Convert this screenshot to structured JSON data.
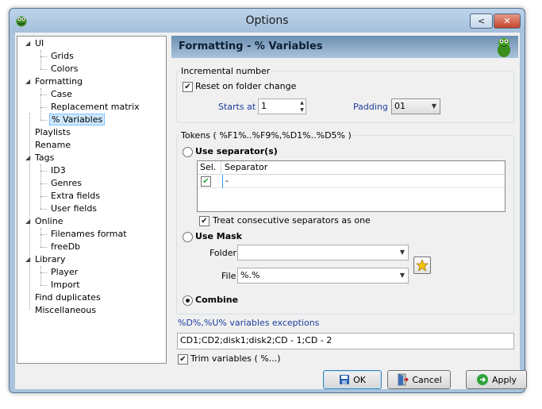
{
  "window": {
    "title": "Options",
    "minimize_glyph": "<",
    "close_glyph": "✕"
  },
  "tree": {
    "items": [
      {
        "label": "UI",
        "expander": "◢"
      },
      {
        "label": "Grids"
      },
      {
        "label": "Colors"
      },
      {
        "label": "Formatting",
        "expander": "◢"
      },
      {
        "label": "Case"
      },
      {
        "label": "Replacement matrix"
      },
      {
        "label": "% Variables",
        "selected": true
      },
      {
        "label": "Playlists"
      },
      {
        "label": "Rename"
      },
      {
        "label": "Tags",
        "expander": "◢"
      },
      {
        "label": "ID3"
      },
      {
        "label": "Genres"
      },
      {
        "label": "Extra fields"
      },
      {
        "label": "User fields"
      },
      {
        "label": "Online",
        "expander": "◢"
      },
      {
        "label": "Filenames format"
      },
      {
        "label": "freeDb"
      },
      {
        "label": "Library",
        "expander": "◢"
      },
      {
        "label": "Player"
      },
      {
        "label": "Import"
      },
      {
        "label": "Find duplicates"
      },
      {
        "label": "Miscellaneous"
      }
    ]
  },
  "panel": {
    "title": "Formatting - % Variables",
    "incremental": {
      "title": "Incremental number",
      "reset_label": "Reset on folder change",
      "reset_checked": true,
      "starts_at_label": "Starts at",
      "starts_at_value": "1",
      "padding_label": "Padding",
      "padding_value": "01"
    },
    "tokens": {
      "title": "Tokens ( %F1%..%F9%,%D1%..%D5% )",
      "use_separators_label": "Use separator(s)",
      "grid_headers": [
        "Sel.",
        "Separator"
      ],
      "grid_rows": [
        {
          "selected": true,
          "separator": "-"
        }
      ],
      "treat_consecutive_label": "Treat consecutive separators as one",
      "treat_consecutive_checked": true,
      "use_mask_label": "Use Mask",
      "folder_label": "Folder",
      "folder_value": "",
      "file_label": "File",
      "file_value": "%.%",
      "combine_label": "Combine",
      "selected_option": "Combine"
    },
    "exceptions": {
      "label": "%D%,%U% variables exceptions",
      "value": "CD1;CD2;disk1;disk2;CD - 1;CD - 2"
    },
    "trim_label": "Trim variables ( %...)",
    "trim_checked": true
  },
  "buttons": {
    "ok": "OK",
    "cancel": "Cancel",
    "apply": "Apply"
  },
  "colors": {
    "header_gradient_top": "#6d8fb0",
    "accent_blue": "#1a3c9c",
    "frame": "#a9c3dd"
  }
}
